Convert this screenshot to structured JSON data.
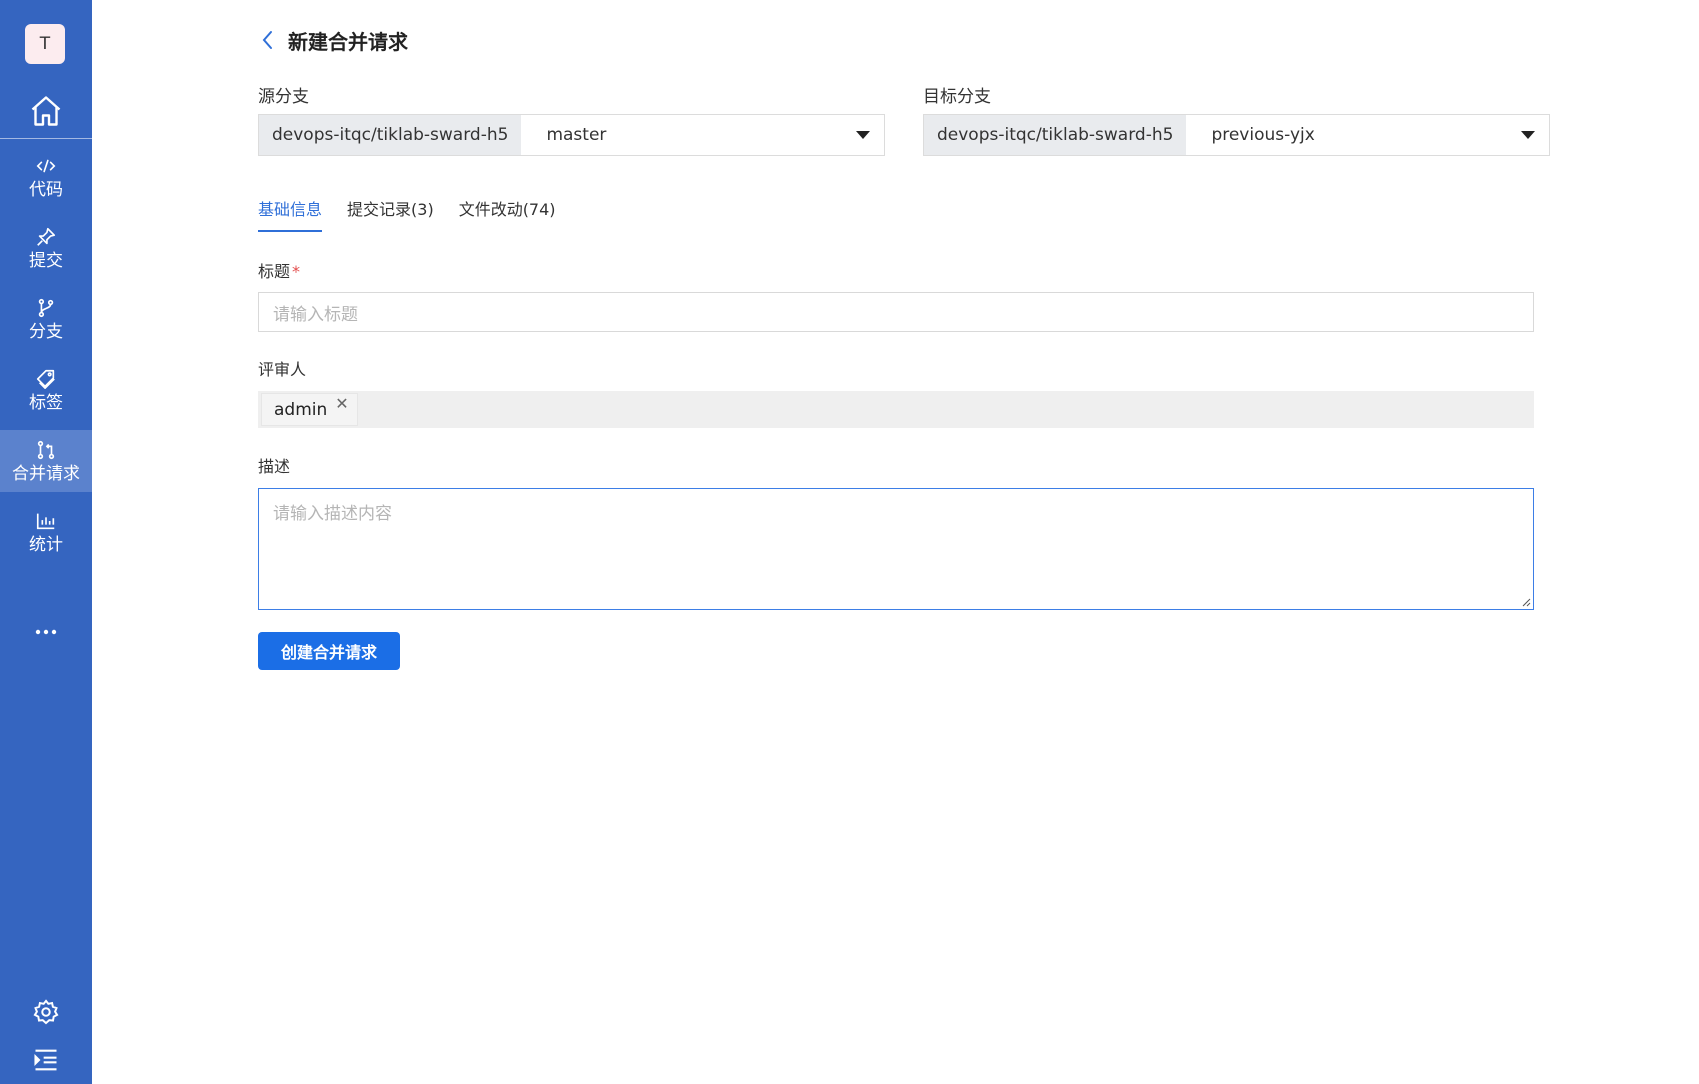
{
  "sidebar": {
    "avatar_letter": "T",
    "items": [
      {
        "label": "代码",
        "icon": "code-icon"
      },
      {
        "label": "提交",
        "icon": "pin-icon"
      },
      {
        "label": "分支",
        "icon": "branch-icon"
      },
      {
        "label": "标签",
        "icon": "tag-icon"
      },
      {
        "label": "合并请求",
        "icon": "merge-request-icon",
        "active": true
      },
      {
        "label": "统计",
        "icon": "chart-icon"
      }
    ]
  },
  "header": {
    "title": "新建合并请求"
  },
  "source_branch": {
    "label": "源分支",
    "repo": "devops-itqc/tiklab-sward-h5",
    "branch": "master"
  },
  "target_branch": {
    "label": "目标分支",
    "repo": "devops-itqc/tiklab-sward-h5",
    "branch": "previous-yjx"
  },
  "tabs": [
    {
      "label": "基础信息",
      "active": true
    },
    {
      "label": "提交记录(3)"
    },
    {
      "label": "文件改动(74)"
    }
  ],
  "form": {
    "title_label": "标题",
    "required_mark": "*",
    "title_placeholder": "请输入标题",
    "reviewer_label": "评审人",
    "reviewers": [
      "admin"
    ],
    "desc_label": "描述",
    "desc_placeholder": "请输入描述内容",
    "submit_label": "创建合并请求"
  },
  "colors": {
    "sidebar": "#3565c0",
    "sidebar_active": "#5b82cd",
    "primary": "#1b6ee6",
    "tab_active": "#2f6fd8",
    "required": "#e34d4d"
  }
}
